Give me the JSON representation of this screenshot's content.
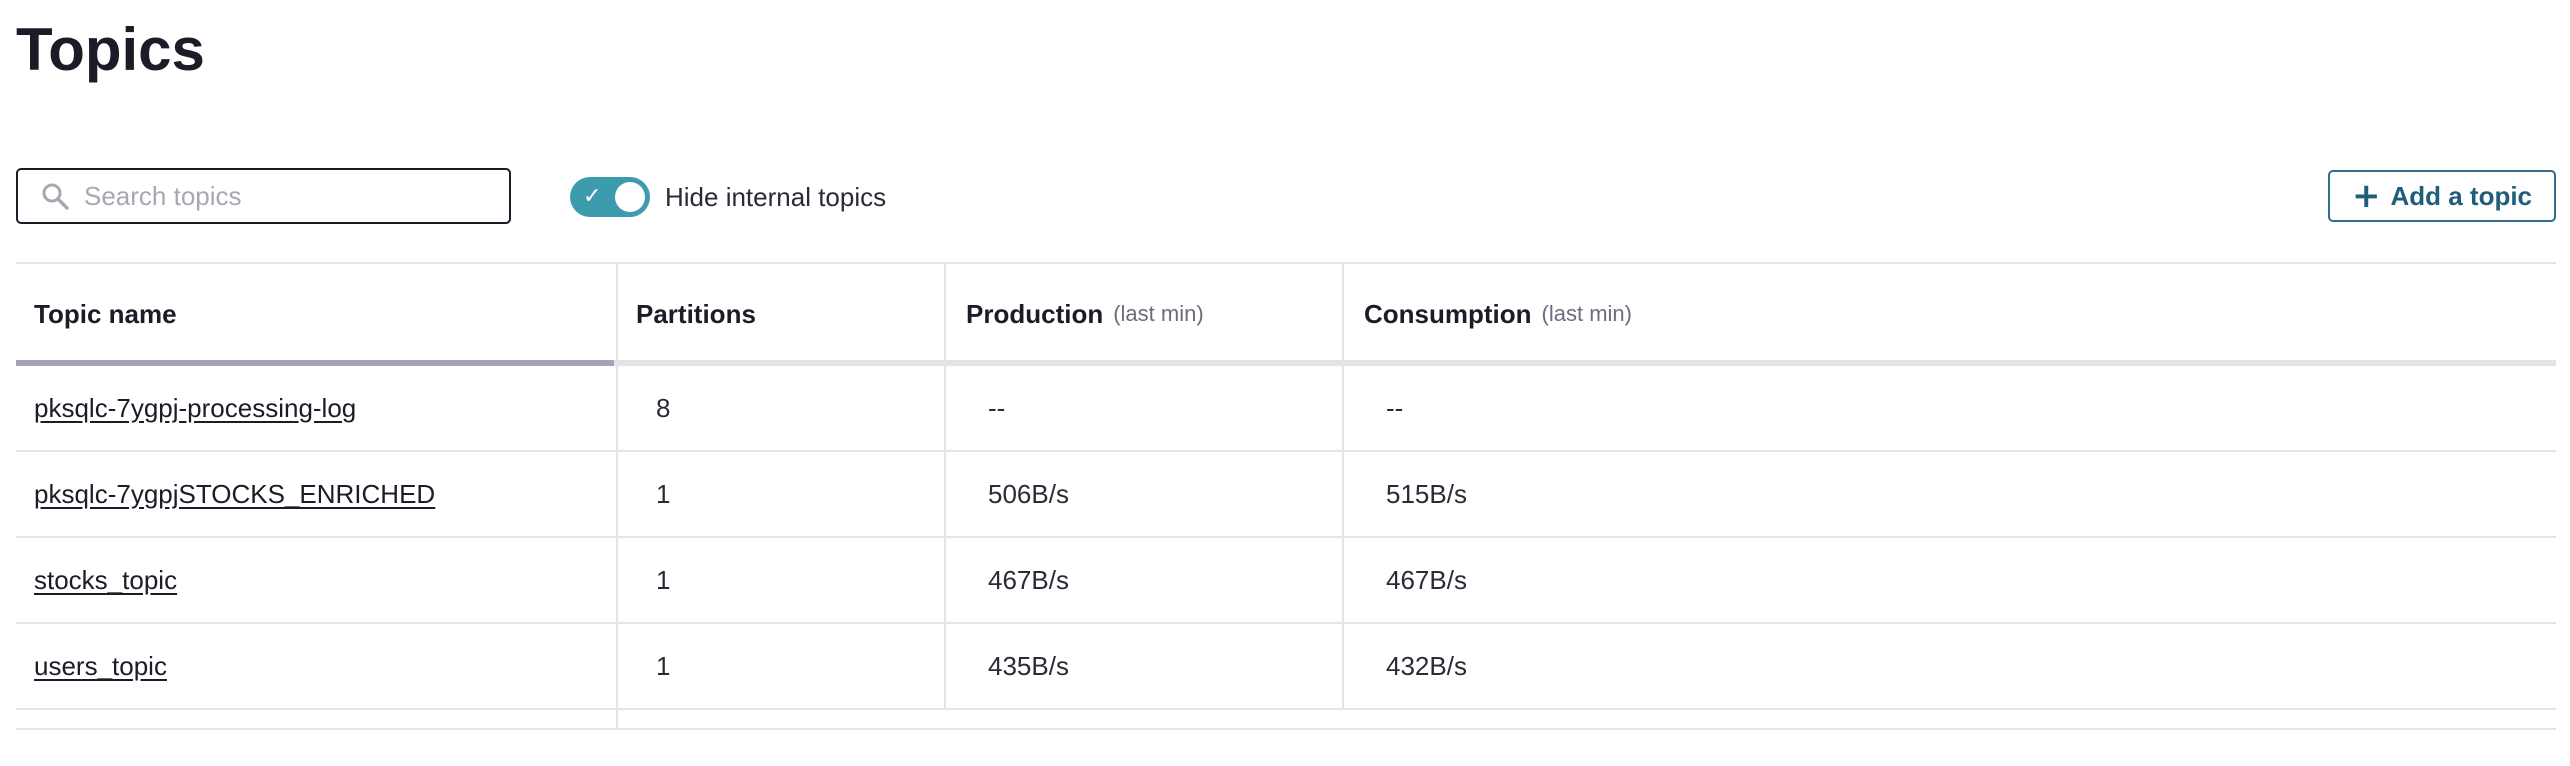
{
  "page": {
    "title": "Topics"
  },
  "toolbar": {
    "search_placeholder": "Search topics",
    "search_value": "",
    "hide_internal_label": "Hide internal topics",
    "hide_internal_checked": true,
    "add_topic_label": "Add a topic",
    "add_topic_icon": "plus-icon",
    "search_icon": "search-icon"
  },
  "table": {
    "columns": [
      {
        "label": "Topic name",
        "note": ""
      },
      {
        "label": "Partitions",
        "note": ""
      },
      {
        "label": "Production",
        "note": "(last min)"
      },
      {
        "label": "Consumption",
        "note": "(last min)"
      }
    ],
    "rows": [
      {
        "name": "pksqlc-7ygpj-processing-log",
        "partitions": "8",
        "production": "--",
        "consumption": "--"
      },
      {
        "name": "pksqlc-7ygpjSTOCKS_ENRICHED",
        "partitions": "1",
        "production": "506B/s",
        "consumption": "515B/s"
      },
      {
        "name": "stocks_topic",
        "partitions": "1",
        "production": "467B/s",
        "consumption": "467B/s"
      },
      {
        "name": "users_topic",
        "partitions": "1",
        "production": "435B/s",
        "consumption": "432B/s"
      }
    ]
  },
  "colors": {
    "toggle_on": "#3d9bae",
    "accent_button": "#1f5d7a",
    "text": "#1c1c28",
    "border": "#e3e3e8"
  }
}
